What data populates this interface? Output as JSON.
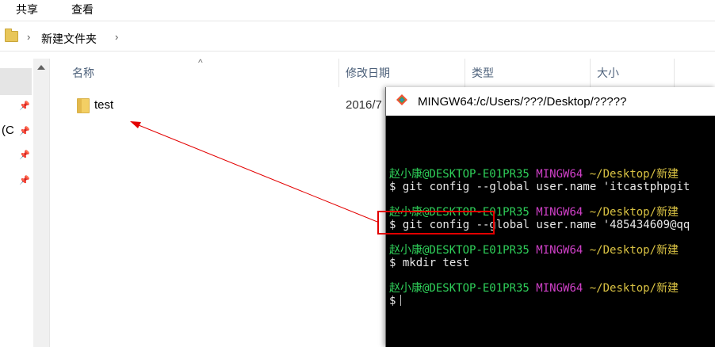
{
  "ribbon": {
    "share": "共享",
    "view": "查看"
  },
  "address": {
    "separator": "›",
    "crumb": "新建文件夹"
  },
  "nav": {
    "label": "(C"
  },
  "columns": {
    "name": "名称",
    "modified": "修改日期",
    "type": "类型",
    "size": "大小"
  },
  "files": [
    {
      "name": "test",
      "modified": "2016/7"
    }
  ],
  "terminal": {
    "title": "MINGW64:/c/Users/???/Desktop/?????",
    "lines": [
      {
        "user": "赵小康@DESKTOP-E01PR35",
        "sys": "MINGW64",
        "path": "~/Desktop/新建"
      },
      {
        "cmd": "$ git config --global user.name 'itcastphpgit"
      },
      {
        "user": "赵小康@DESKTOP-E01PR35",
        "sys": "MINGW64",
        "path": "~/Desktop/新建"
      },
      {
        "cmd": "$ git config --global user.name '485434609@qq"
      },
      {
        "user": "赵小康@DESKTOP-E01PR35",
        "sys": "MINGW64",
        "path": "~/Desktop/新建"
      },
      {
        "cmd": "$ mkdir test"
      },
      {
        "user": "赵小康@DESKTOP-E01PR35",
        "sys": "MINGW64",
        "path": "~/Desktop/新建"
      },
      {
        "cmd": "$"
      }
    ]
  },
  "colors": {
    "highlight": "#e30000",
    "prompt_user": "#2fd15a",
    "prompt_sys": "#d040c8",
    "prompt_path": "#d9c243"
  }
}
